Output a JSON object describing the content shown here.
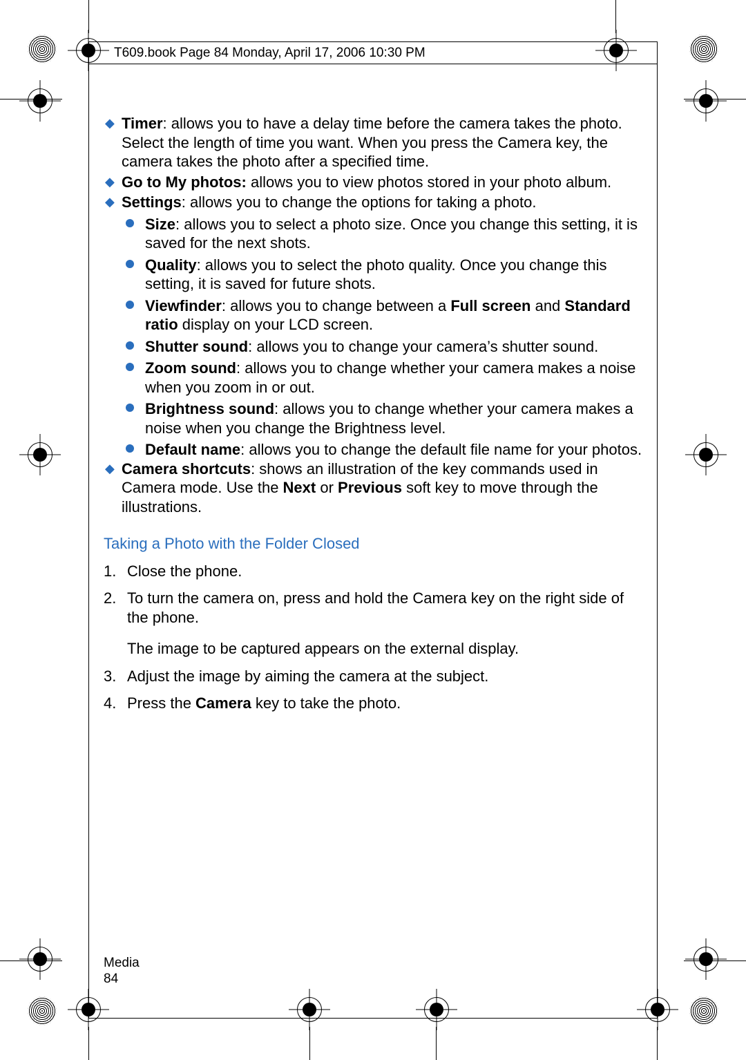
{
  "header": "T609.book  Page 84  Monday, April 17, 2006  10:30 PM",
  "items": {
    "timer": {
      "label": "Timer",
      "text": ": allows you to have a delay time before the camera takes the photo. Select the length of time you want. When you press the Camera key, the camera takes the photo after a specified time."
    },
    "goto": {
      "label": "Go to My photos:",
      "text": " allows you to view photos stored in your photo album."
    },
    "settings": {
      "label": "Settings",
      "text": ": allows you to change the options for taking a photo."
    },
    "sub": {
      "size": {
        "label": "Size",
        "text": ": allows you to select a photo size. Once you change this setting, it is saved for the next shots."
      },
      "quality": {
        "label": "Quality",
        "text": ": allows you to select the photo quality. Once you change this setting, it is saved for future shots."
      },
      "viewfinder": {
        "label": "Viewfinder",
        "text_a": ": allows you to change between a ",
        "bold_a": "Full screen",
        "text_b": " and ",
        "bold_b": "Standard ratio",
        "text_c": " display on your LCD screen."
      },
      "shutter": {
        "label": "Shutter sound",
        "text": ": allows you to change your camera’s shutter sound."
      },
      "zoom": {
        "label": "Zoom sound",
        "text": ": allows you to change whether your camera makes a noise when you zoom in or out."
      },
      "brightness": {
        "label": "Brightness sound",
        "text": ": allows you to change whether your camera makes a noise when you change the Brightness level."
      },
      "defaultname": {
        "label": "Default name",
        "text": ": allows you to change the default file name for your photos."
      }
    },
    "shortcuts": {
      "label": "Camera shortcuts",
      "text_a": ": shows an illustration of the key commands used in Camera mode. Use the ",
      "bold_a": "Next",
      "text_b": " or ",
      "bold_b": "Previous",
      "text_c": " soft key to move through the illustrations."
    }
  },
  "section_title": "Taking a Photo with the Folder Closed",
  "steps": {
    "n1": "1.",
    "s1": "Close the phone.",
    "n2": "2.",
    "s2": "To turn the camera on, press and hold the Camera key on the right side of the phone.",
    "s2b": "The image to be captured appears on the external display.",
    "n3": "3.",
    "s3": "Adjust the image by aiming the camera at the subject.",
    "n4": "4.",
    "s4a": "Press the ",
    "s4bold": "Camera",
    "s4b": " key to take the photo."
  },
  "footer": {
    "section": "Media",
    "page": "84"
  }
}
